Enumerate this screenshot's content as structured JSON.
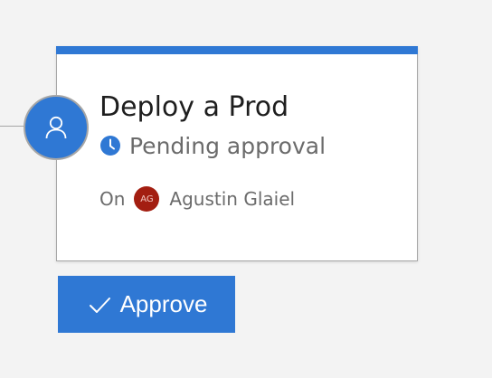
{
  "stage": {
    "title": "Deploy a Prod",
    "status": "Pending approval",
    "on_label": "On",
    "user_initials": "AG",
    "user_name": "Agustin Glaiel"
  },
  "actions": {
    "approve_label": "Approve"
  },
  "icons": {
    "stage_icon": "user-icon",
    "status_icon": "clock-icon",
    "approve_icon": "checkmark-icon"
  },
  "colors": {
    "accent": "#2f78d4",
    "avatar_bg": "#a31e11",
    "background": "#f3f3f3"
  }
}
